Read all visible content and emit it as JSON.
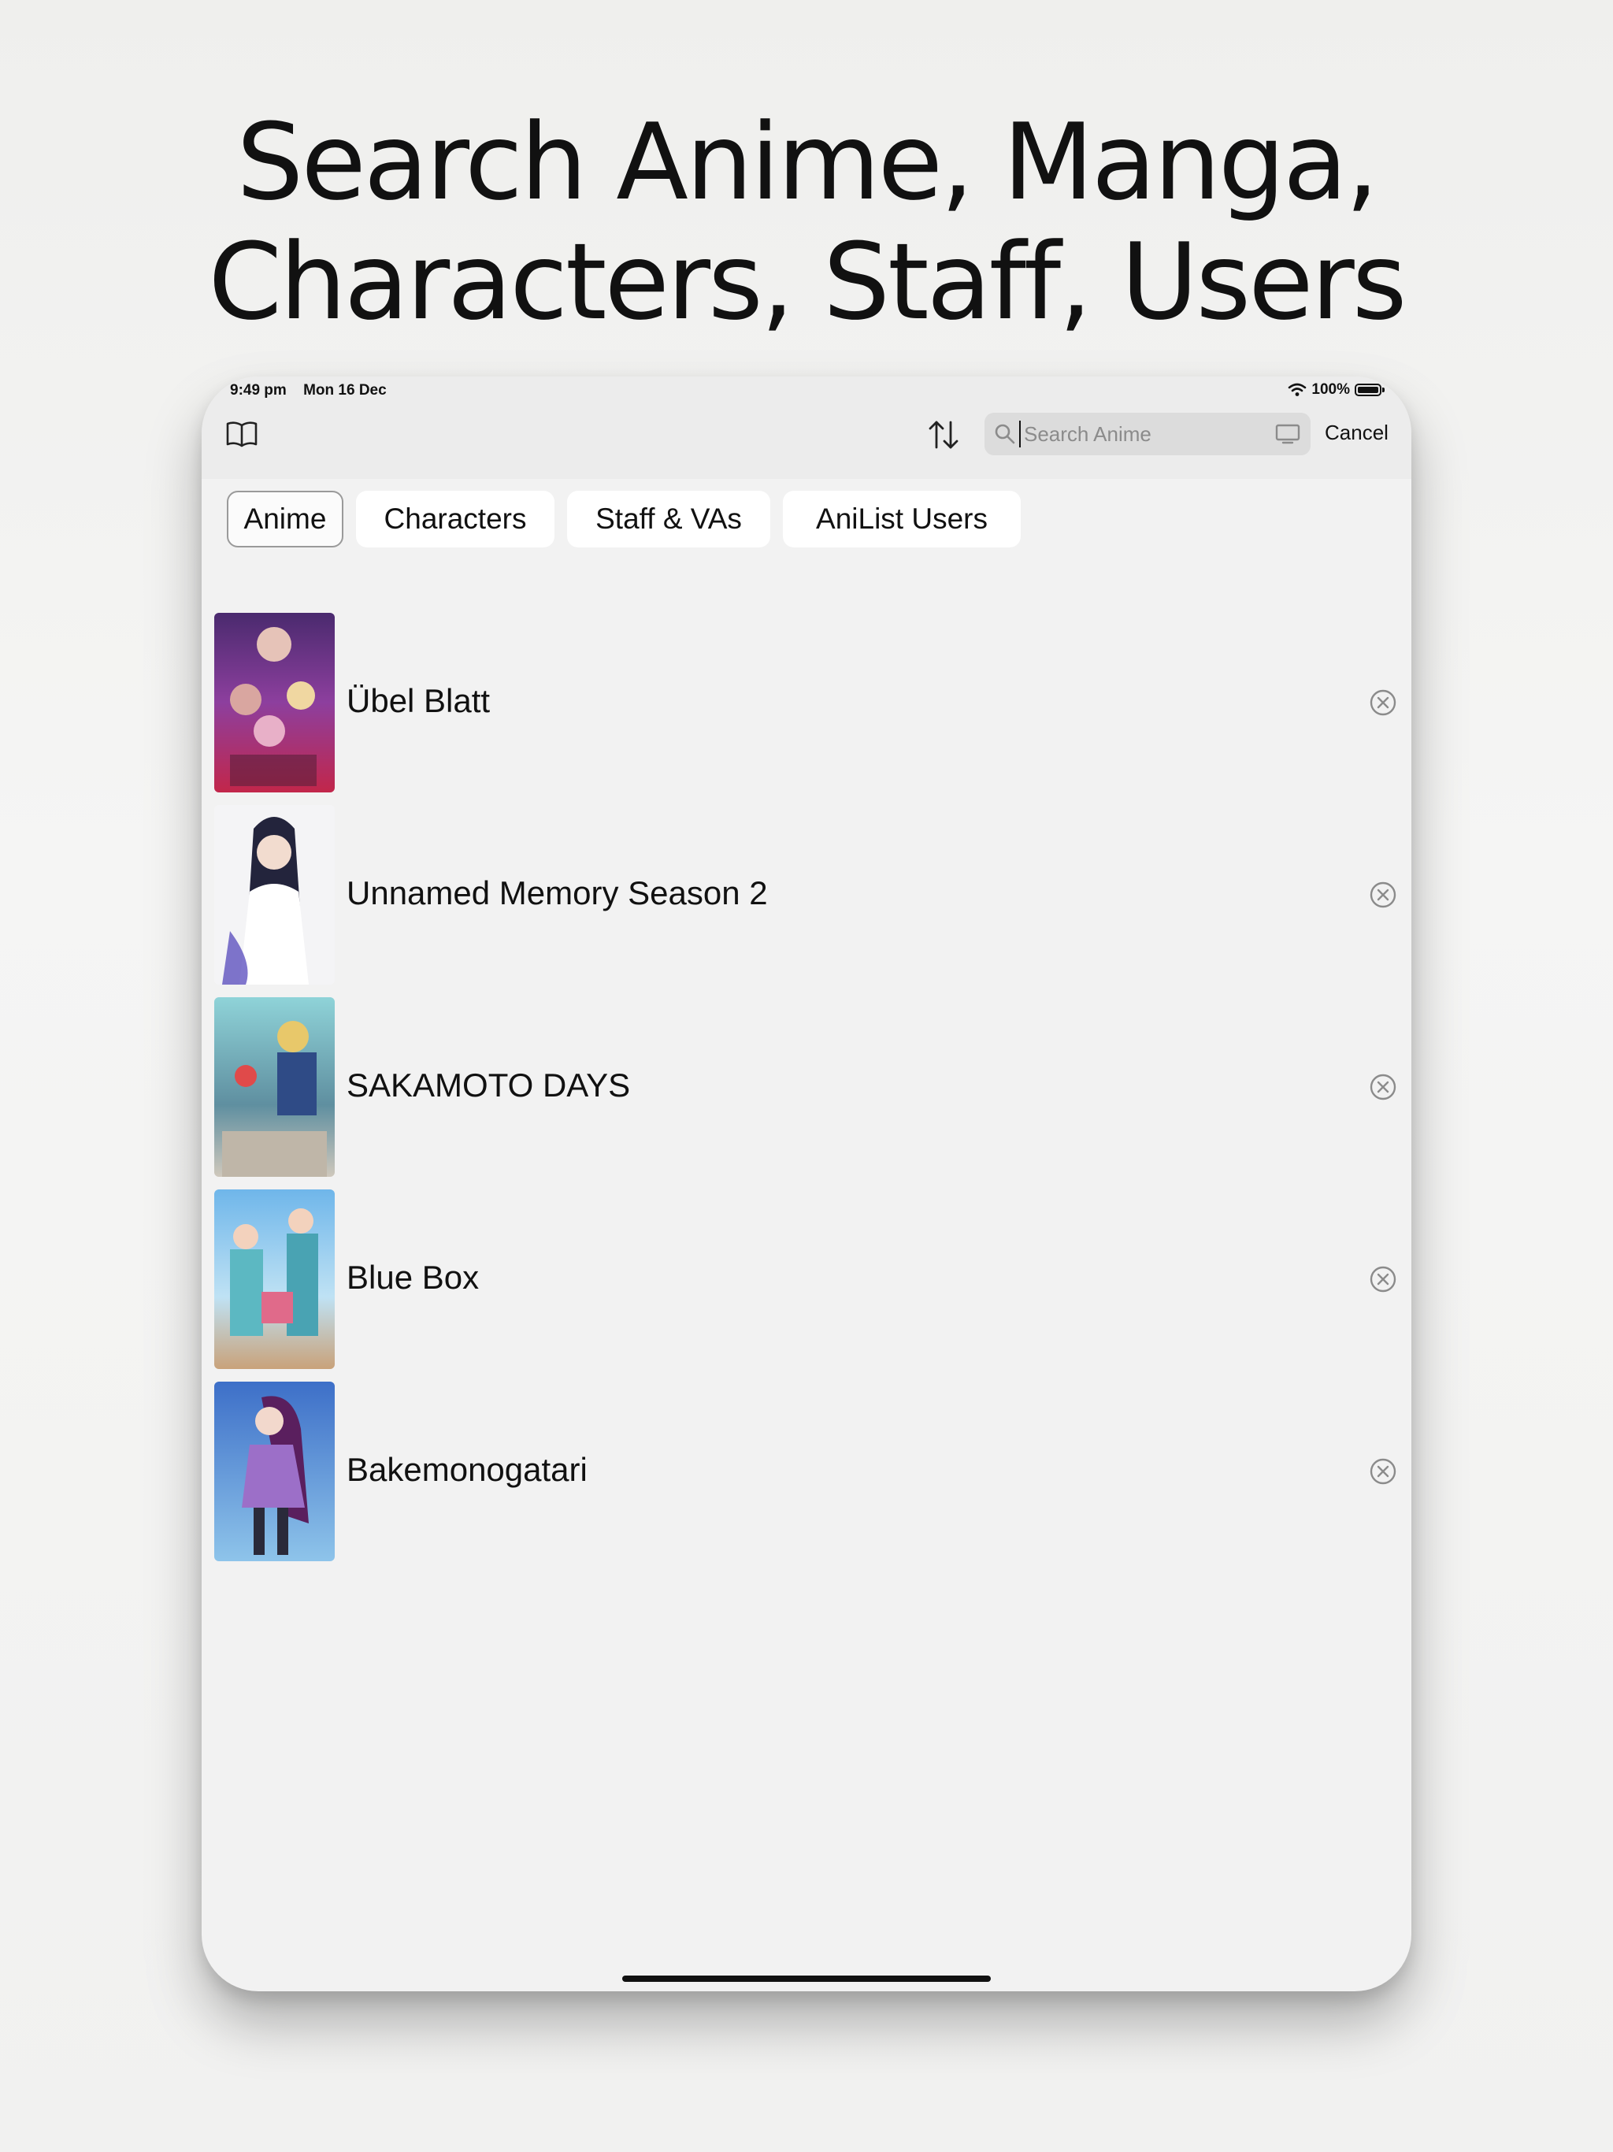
{
  "headline": {
    "line1": "Search Anime, Manga,",
    "line2": "Characters, Staff, Users"
  },
  "status_bar": {
    "time": "9:49 pm",
    "date": "Mon 16 Dec",
    "battery": "100%"
  },
  "toolbar": {
    "library_icon": "book-icon",
    "sort_icon": "sort-arrows-icon",
    "search_placeholder": "Search Anime",
    "search_value": "",
    "display_icon": "display-icon",
    "cancel_label": "Cancel"
  },
  "tabs": [
    {
      "label": "Anime",
      "selected": true
    },
    {
      "label": "Characters",
      "selected": false
    },
    {
      "label": "Staff & VAs",
      "selected": false
    },
    {
      "label": "AniList Users",
      "selected": false
    }
  ],
  "recent_searches": [
    {
      "title": "Übel Blatt"
    },
    {
      "title": "Unnamed Memory Season 2"
    },
    {
      "title": "SAKAMOTO DAYS"
    },
    {
      "title": "Blue Box"
    },
    {
      "title": "Bakemonogatari"
    }
  ],
  "colors": {
    "background": "#f2f2f2",
    "toolbar": "#ececec",
    "search_field": "#dcdcdc",
    "text": "#111111"
  }
}
